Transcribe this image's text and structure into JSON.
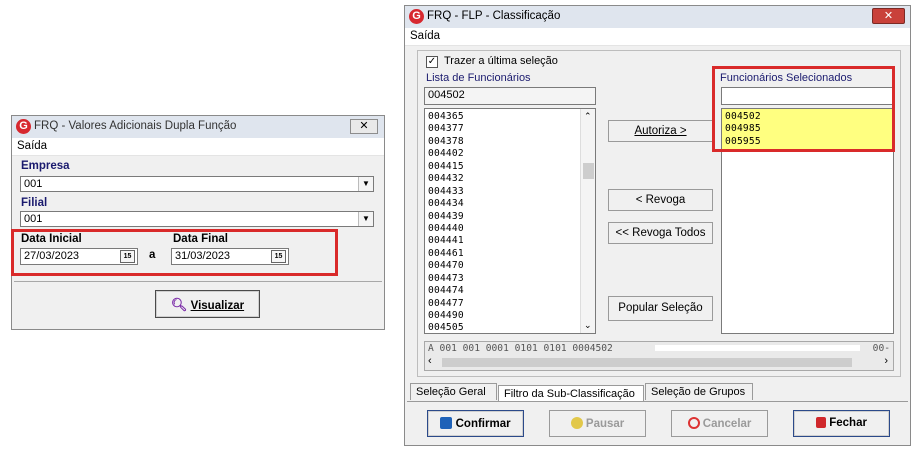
{
  "left_window": {
    "title": "FRQ -  Valores Adicionais Dupla Função",
    "menu": "Saída",
    "empresa_label": "Empresa",
    "empresa_value": "001",
    "filial_label": "Filial",
    "filial_value": "001",
    "data_inicial_label": "Data Inicial",
    "data_inicial_value": "27/03/2023",
    "a_label": "a",
    "data_final_label": "Data Final",
    "data_final_value": "31/03/2023",
    "visualizar_label": "Visualizar",
    "calendar_glyph": "15"
  },
  "right_window": {
    "title": "FRQ - FLP - Classificação",
    "menu": "Saída",
    "checkbox_label": "Trazer a última seleção",
    "checkbox_checked": true,
    "lista_label": "Lista de Funcionários",
    "search_value": "004502",
    "lista_items": [
      "004365",
      "004377",
      "004378",
      "004402",
      "004415",
      "004432",
      "004433",
      "004434",
      "004439",
      "004440",
      "004441",
      "004461",
      "004470",
      "004473",
      "004474",
      "004477",
      "004490",
      "004505"
    ],
    "selecionados_label": "Funcionários Selecionados",
    "selecionados_search_value": "",
    "selecionados_items": [
      "004502",
      "004985",
      "005955"
    ],
    "buttons": {
      "autoriza": "Autoriza >",
      "revoga": "< Revoga",
      "revoga_todos": "<< Revoga Todos",
      "popular": "Popular Seleção"
    },
    "status_text": "A 001 001 0001 0101 0101 0004502",
    "status_tail": "00-",
    "tabs": [
      "Seleção Geral",
      "Filtro da Sub-Classificação",
      "Seleção de Grupos"
    ],
    "confirmar": "Confirmar",
    "pausar": "Pausar",
    "cancelar": "Cancelar",
    "fechar": "Fechar",
    "highlight_color": "#ffff80",
    "accent_red": "#d92a2a"
  }
}
